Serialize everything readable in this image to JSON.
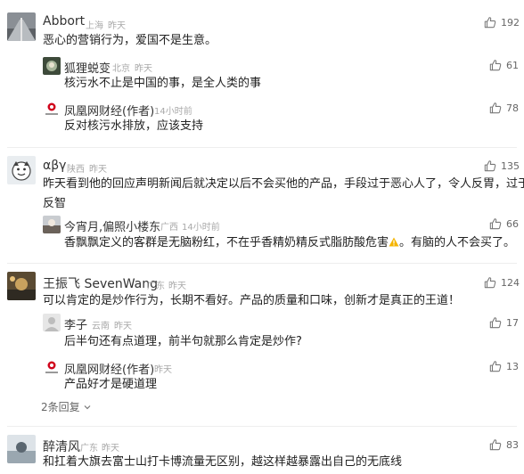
{
  "comments": [
    {
      "user": "Abbort",
      "location": "上海",
      "time": "昨天",
      "text": "恶心的营销行为，爱国不是生意。",
      "likes": "192",
      "replies": [
        {
          "user": "狐狸蜕变",
          "location": "北京",
          "time": "昨天",
          "text": "核污水不止是中国的事，是全人类的事",
          "likes": "61"
        },
        {
          "user": "凤凰网财经(作者)",
          "location": "",
          "time": "14小时前",
          "text": "反对核污水排放，应该支持",
          "likes": "78"
        }
      ]
    },
    {
      "user": "αβγ",
      "location": "陕西",
      "time": "昨天",
      "text_line1": "昨天看到他的回应声明新闻后就决定以后不会买他的产品，手段过于恶心人了，令人反胃，过于",
      "text_line2": "反智",
      "likes": "135",
      "replies": [
        {
          "user": "今宵月,偏照小楼东",
          "location": "广西",
          "time": "14小时前",
          "text_before": "香飘飘定义的客群是无脑粉红，不在乎香精奶精反式脂肪酸危害",
          "text_after": "。有脑的人不会买了。",
          "likes": "66"
        }
      ]
    },
    {
      "user": "王振飞 SevenWang",
      "location": "广东",
      "time": "昨天",
      "text": "可以肯定的是炒作行为，长期不看好。产品的质量和口味，创新才是真正的王道！",
      "likes": "124",
      "replies": [
        {
          "user": "李子",
          "location": "云南",
          "time": "昨天",
          "text": "后半句还有点道理，前半句就那么肯定是炒作?",
          "likes": "17"
        },
        {
          "user": "凤凰网财经(作者)",
          "location": "",
          "time": "昨天",
          "text": "产品好才是硬道理",
          "likes": "13"
        }
      ],
      "more_replies": "2条回复"
    },
    {
      "user": "醉清风",
      "location": "广东",
      "time": "昨天",
      "text": "和扛着大旗去富士山打卡博流量无区别，越这样越暴露出自己的无底线",
      "likes": "83"
    }
  ],
  "icons": {
    "like": "thumbs-up-icon",
    "expand": "chevron-down-icon",
    "warning": "warning-icon"
  },
  "colors": {
    "meta": "#a8a8a8",
    "divider": "#eeeeee",
    "warning": "#f5b400",
    "brand_red": "#d0021b"
  }
}
